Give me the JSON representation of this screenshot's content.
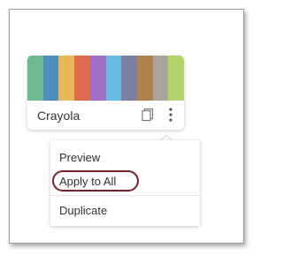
{
  "palette": {
    "name": "Crayola",
    "swatches": [
      "#6fb993",
      "#4a8fbe",
      "#e9b957",
      "#e06b4e",
      "#9d6ec6",
      "#6bbbe3",
      "#7b7fa6",
      "#b1804f",
      "#a9a49c",
      "#b1d36a"
    ]
  },
  "icons": {
    "copy": "copy-icon",
    "more": "more-vertical-icon"
  },
  "menu": {
    "preview_label": "Preview",
    "apply_all_label": "Apply to All",
    "duplicate_label": "Duplicate"
  },
  "colors": {
    "highlight_ring": "#7a1f2b"
  }
}
